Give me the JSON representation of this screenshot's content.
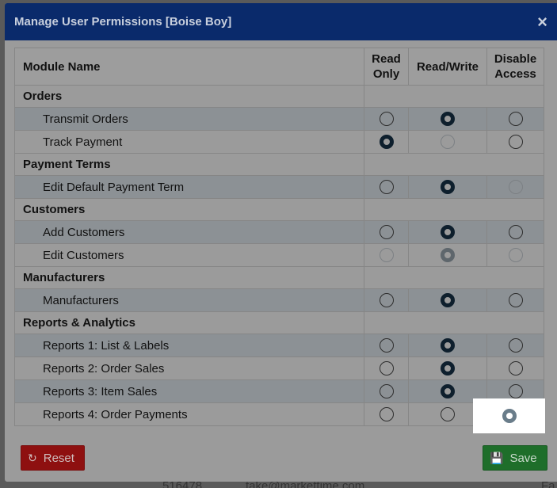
{
  "dialog": {
    "title": "Manage User Permissions [Boise Boy]",
    "close_glyph": "×",
    "close_icon": "close-icon"
  },
  "table": {
    "headers": {
      "module": "Module Name",
      "read_only": "Read Only",
      "read_write": "Read/Write",
      "disable": "Disable Access"
    },
    "groups": [
      {
        "name": "Orders",
        "items": [
          {
            "label": "Transmit Orders",
            "selected": "read_write",
            "disabled": []
          },
          {
            "label": "Track Payment",
            "selected": "read_only",
            "disabled": [
              "read_write"
            ]
          }
        ]
      },
      {
        "name": "Payment Terms",
        "items": [
          {
            "label": "Edit Default Payment Term",
            "selected": "read_write",
            "disabled": [
              "disable"
            ]
          }
        ]
      },
      {
        "name": "Customers",
        "items": [
          {
            "label": "Add Customers",
            "selected": "read_write",
            "disabled": []
          },
          {
            "label": "Edit Customers",
            "selected": "read_write",
            "disabled": [
              "read_only",
              "read_write",
              "disable"
            ]
          }
        ]
      },
      {
        "name": "Manufacturers",
        "items": [
          {
            "label": "Manufacturers",
            "selected": "read_write",
            "disabled": []
          }
        ]
      },
      {
        "name": "Reports & Analytics",
        "items": [
          {
            "label": "Reports 1: List & Labels",
            "selected": "read_write",
            "disabled": []
          },
          {
            "label": "Reports 2: Order Sales",
            "selected": "read_write",
            "disabled": []
          },
          {
            "label": "Reports 3: Item Sales",
            "selected": "read_write",
            "disabled": []
          },
          {
            "label": "Reports 4: Order Payments",
            "selected": "disable",
            "disabled": []
          }
        ]
      }
    ]
  },
  "buttons": {
    "reset_label": "Reset",
    "reset_icon": "refresh-icon",
    "save_label": "Save",
    "save_icon": "floppy-disk-icon"
  },
  "colors": {
    "header": "#0a2a6b",
    "reset": "#8e1010",
    "save": "#1e6e2a"
  },
  "backdrop": {
    "t1": "516478",
    "t2": "take@markettime.com",
    "t3": "Fa"
  }
}
